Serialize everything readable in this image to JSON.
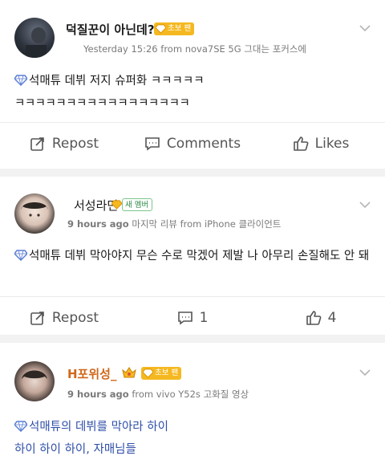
{
  "posts": [
    {
      "username": "덕질꾼이 아닌데?",
      "badge": "초보 팬",
      "time": "Yesterday 15:26",
      "source": " from nova7SE 5G 그대는 포커스에",
      "text_line1": "석매튜 데뷔 저지 슈퍼화 ㅋㅋㅋㅋㅋ",
      "text_line2": "ㅋㅋㅋㅋㅋㅋㅋㅋㅋㅋㅋㅋㅋㅋㅋㅋㅋ",
      "actions": {
        "repost": "Repost",
        "comments": "Comments",
        "likes": "Likes"
      }
    },
    {
      "username": "서성라면",
      "badge": "새 멤버",
      "time": "9 hours ago",
      "source": " 마지막 리뷰 from iPhone 클라이언트",
      "text_line1": "석매튜 데뷔 막아야지 무슨 수로 막겠어 제발 나 아무리 손질해도 안 돼",
      "actions": {
        "repost": "Repost",
        "comments": "1",
        "likes": "4"
      }
    },
    {
      "username": "H포위성_",
      "badge": "초보 팬",
      "time": "9 hours ago",
      "source": " from vivo Y52s 고화질 영상",
      "text_line1": "석매튜의 데뷔를 막아라 하이",
      "text_line2": "하이 하이 하이, 자매님들"
    }
  ],
  "colors": {
    "accent": "#5b7fd6",
    "username_orange": "#d0681c",
    "badge_yellow": "#f5b820",
    "badge_green": "#7cc68d"
  }
}
